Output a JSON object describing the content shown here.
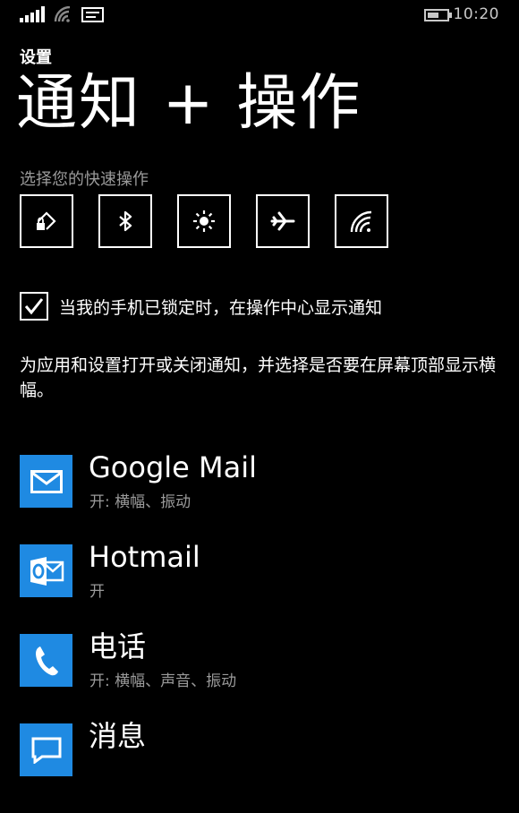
{
  "status_bar": {
    "time": "10:20",
    "icons": [
      "signal-icon",
      "wifi-icon",
      "message-icon",
      "battery-icon"
    ]
  },
  "header": {
    "section": "设置",
    "title": "通知 + 操作"
  },
  "quick_actions": {
    "label": "选择您的快速操作",
    "items": [
      {
        "icon": "rotation-lock-icon"
      },
      {
        "icon": "bluetooth-icon"
      },
      {
        "icon": "brightness-icon"
      },
      {
        "icon": "airplane-mode-icon"
      },
      {
        "icon": "wifi-icon"
      }
    ]
  },
  "lock_screen_option": {
    "checked": true,
    "label": "当我的手机已锁定时，在操作中心显示通知"
  },
  "description": "为应用和设置打开或关闭通知，并选择是否要在屏幕顶部显示横幅。",
  "apps": [
    {
      "name": "Google Mail",
      "status": "开: 横幅、振动",
      "icon": "mail-icon"
    },
    {
      "name": "Hotmail",
      "status": "开",
      "icon": "outlook-icon"
    },
    {
      "name": "电话",
      "status": "开: 横幅、声音、振动",
      "icon": "phone-icon"
    },
    {
      "name": "消息",
      "status": "",
      "icon": "message-icon"
    }
  ],
  "colors": {
    "accent": "#1f8ae2",
    "background": "#000000",
    "text": "#ffffff",
    "subtext": "#9a9a9a"
  }
}
